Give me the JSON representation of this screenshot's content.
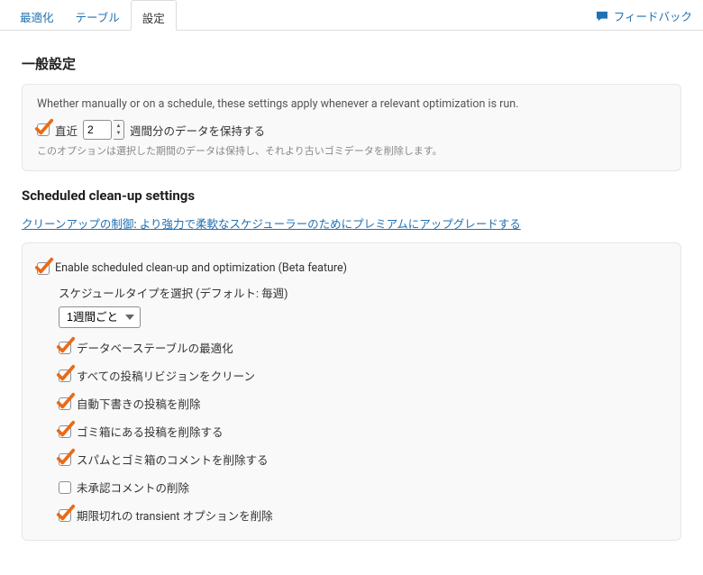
{
  "tabs": {
    "optimize": "最適化",
    "table": "テーブル",
    "settings": "設定"
  },
  "feedback_label": "フィードバック",
  "general_heading": "一般設定",
  "general_panel": {
    "description": "Whether manually or on a schedule, these settings apply whenever a relevant optimization is run.",
    "retain_prefix": "直近",
    "retain_weeks_value": "2",
    "retain_suffix": "週間分のデータを保持する",
    "retain_checked": true,
    "hint": "このオプションは選択した期間のデータは保持し、それより古いゴミデータを削除します。"
  },
  "scheduled_heading": "Scheduled clean-up settings",
  "premium_link": "クリーンアップの制御: より強力で柔軟なスケジューラーのためにプレミアムにアップグレードする",
  "scheduled_panel": {
    "enable_label": "Enable scheduled clean-up and optimization (Beta feature)",
    "enable_checked": true,
    "schedule_type_label": "スケジュールタイプを選択 (デフォルト: 毎週)",
    "schedule_type_value": "1週間ごと",
    "options": [
      {
        "label": "データベーステーブルの最適化",
        "checked": true
      },
      {
        "label": "すべての投稿リビジョンをクリーン",
        "checked": true
      },
      {
        "label": "自動下書きの投稿を削除",
        "checked": true
      },
      {
        "label": "ゴミ箱にある投稿を削除する",
        "checked": true
      },
      {
        "label": "スパムとゴミ箱のコメントを削除する",
        "checked": true
      },
      {
        "label": "未承認コメントの削除",
        "checked": false
      },
      {
        "label": "期限切れの transient オプションを削除",
        "checked": true
      }
    ]
  }
}
